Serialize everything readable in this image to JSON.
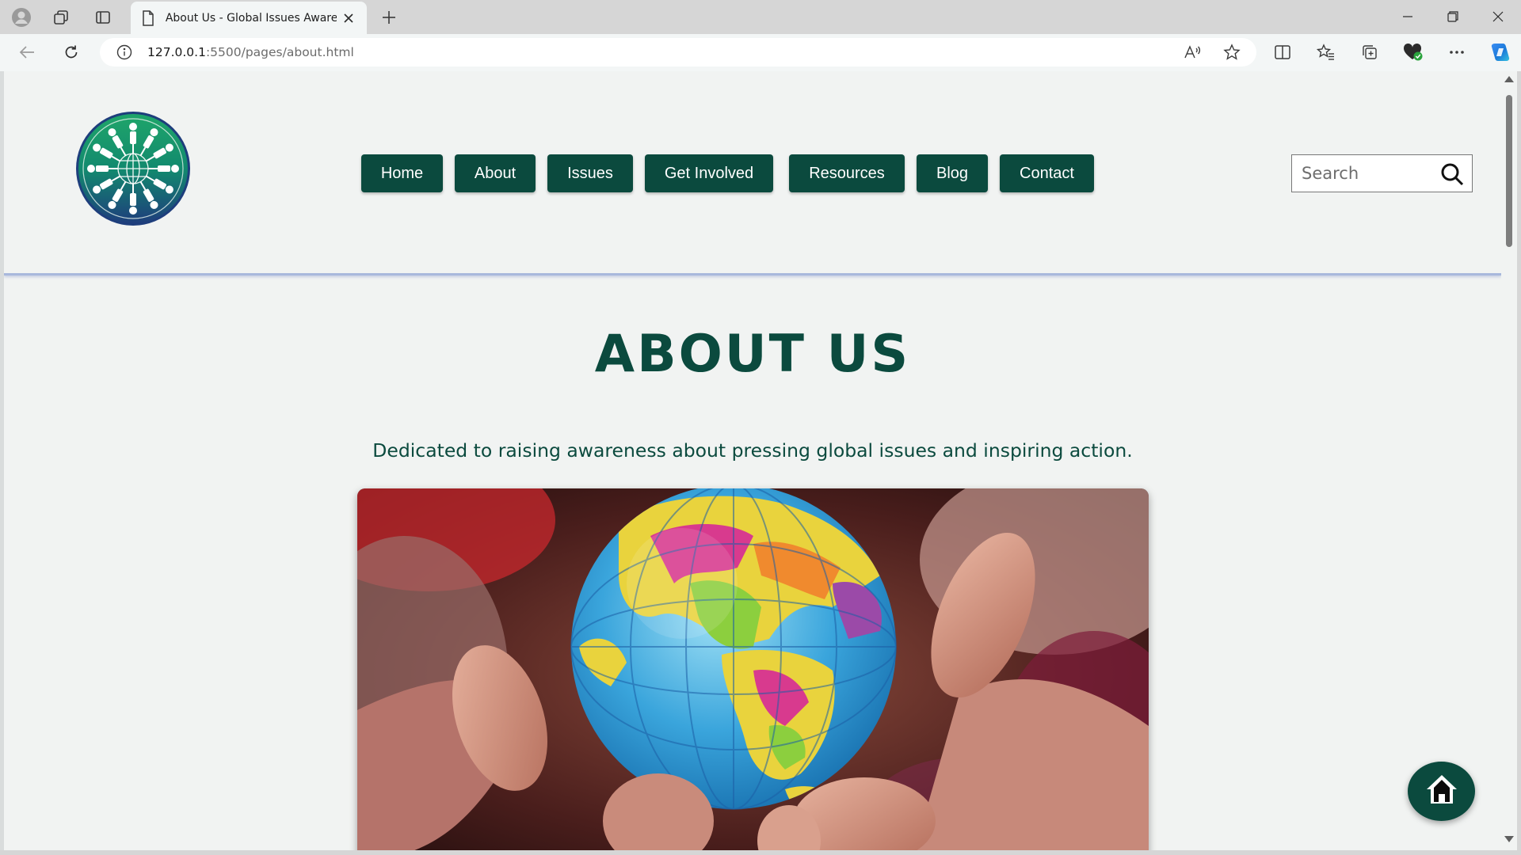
{
  "browser": {
    "tab_title": "About Us - Global Issues Awaren",
    "url_host": "127.0.0.1",
    "url_rest": ":5500/pages/about.html"
  },
  "site": {
    "nav": [
      "Home",
      "About",
      "Issues",
      "Get Involved",
      "Resources",
      "Blog",
      "Contact"
    ],
    "search_placeholder": "Search"
  },
  "page": {
    "heading": "ABOUT US",
    "tagline": "Dedicated to raising awareness about pressing global issues and inspiring action."
  },
  "icons": {
    "profile": "profile-icon",
    "workspaces": "workspaces-icon",
    "tab_actions": "tab-actions-icon",
    "home_fab": "home-icon",
    "search": "search-icon"
  },
  "colors": {
    "brand": "#0b4a3e",
    "page_bg": "#f1f3f2",
    "header_border": "#a8b8dc"
  }
}
